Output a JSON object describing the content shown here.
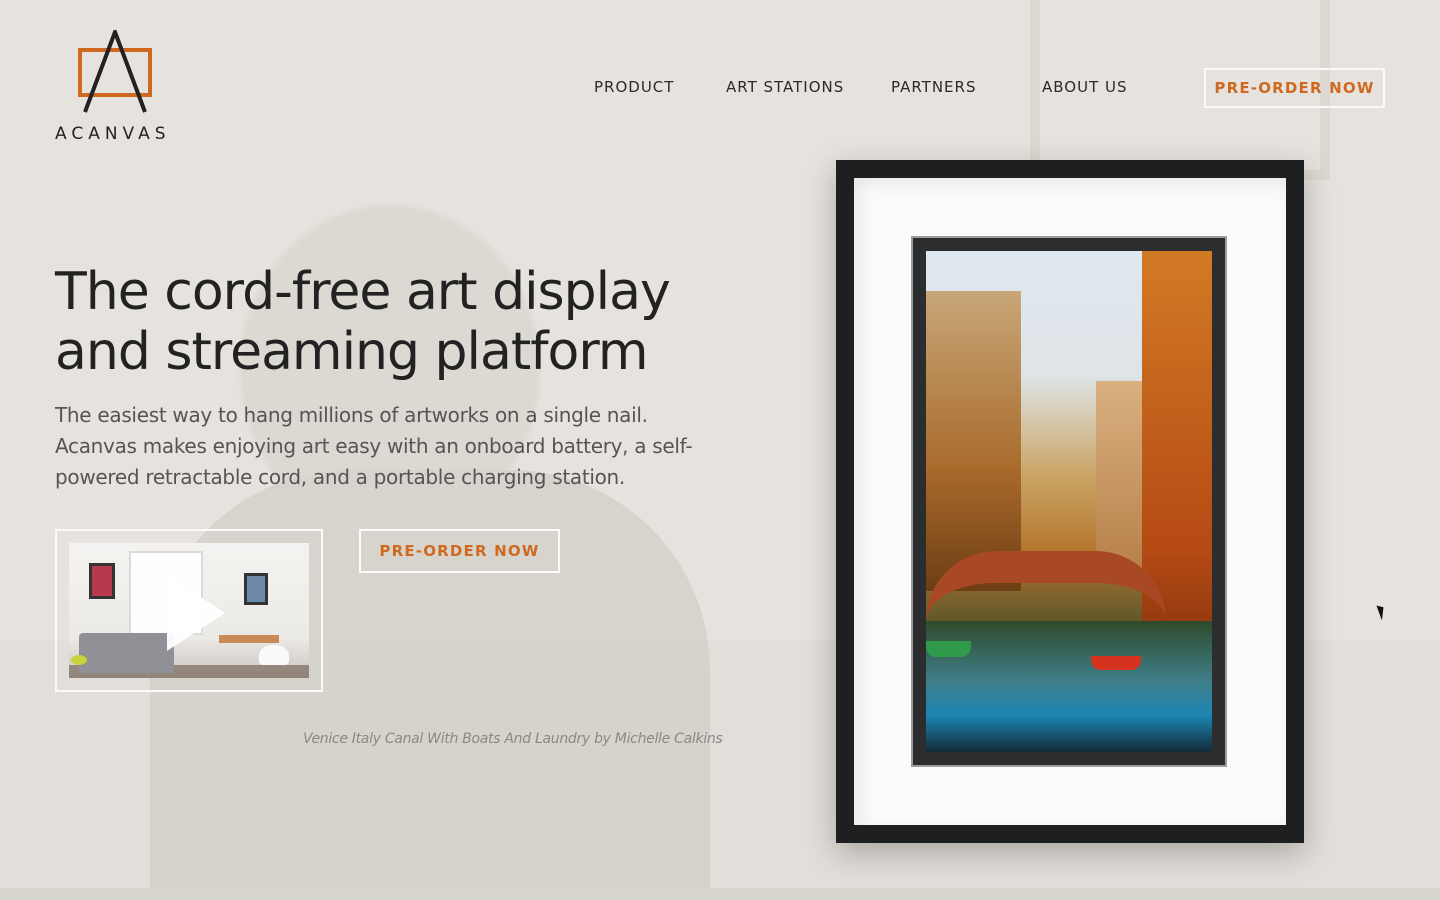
{
  "brand": {
    "name": "ACANVAS",
    "accent_color": "#d0691f"
  },
  "nav": {
    "items": [
      "PRODUCT",
      "ART STATIONS",
      "PARTNERS",
      "ABOUT US"
    ],
    "cta_label": "PRE-ORDER NOW"
  },
  "hero": {
    "headline": "The cord-free art display and streaming platform",
    "subtext": "The easiest way to hang millions of artworks on a single nail. Acanvas makes enjoying art easy with an onboard battery, a self-powered retractable cord, and a portable charging station.",
    "cta_label": "PRE-ORDER NOW",
    "video_icon": "play-icon",
    "artwork_caption": "Venice Italy Canal With Boats And Laundry by Michelle Calkins"
  }
}
